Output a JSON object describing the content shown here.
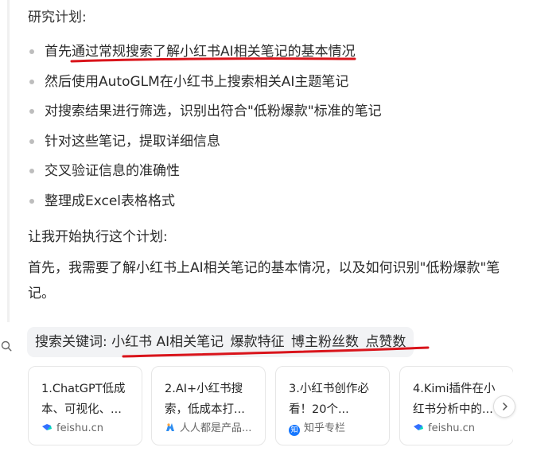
{
  "plan": {
    "heading": "研究计划:",
    "items": [
      "首先通过常规搜索了解小红书AI相关笔记的基本情况",
      "然后使用AutoGLM在小红书上搜索相关AI主题笔记",
      "对搜索结果进行筛选，识别出符合\"低粉爆款\"标准的笔记",
      "针对这些笔记，提取详细信息",
      "交叉验证信息的准确性",
      "整理成Excel表格格式"
    ]
  },
  "paragraphs": {
    "start": "让我开始执行这个计划:",
    "first": "首先，我需要了解小红书上AI相关笔记的基本情况，以及如何识别\"低粉爆款\"笔记。"
  },
  "search": {
    "label": "搜索关键词:",
    "keywords": [
      "小红书 AI相关笔记",
      "爆款特征",
      "博主粉丝数",
      "点赞数"
    ]
  },
  "results": [
    {
      "title": "1.ChatGPT低成本、可视化、...",
      "source": "feishu.cn",
      "icon": "feishu-icon"
    },
    {
      "title": "2.AI+小红书搜索，低成本打...",
      "source": "人人都是产品...",
      "icon": "woshipm-icon"
    },
    {
      "title": "3.小红书创作必看！20个...",
      "source": "知乎专栏",
      "icon": "zhihu-icon",
      "icon_text": "知"
    },
    {
      "title": "4.Kimi插件在小红书分析中的...",
      "source": "feishu.cn",
      "icon": "feishu-icon"
    }
  ],
  "colors": {
    "annotation_red": "#d9141b",
    "search_bg": "#f2f3f5",
    "bullet": "#bdbdbd"
  }
}
